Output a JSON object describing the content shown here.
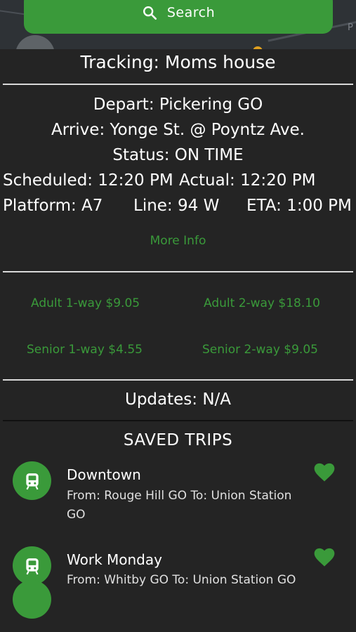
{
  "search": {
    "label": "Search"
  },
  "map": {
    "corner_letter": "P"
  },
  "tracking": {
    "title": "Tracking: Moms house",
    "depart": "Depart: Pickering GO",
    "arrive": "Arrive: Yonge St. @ Poyntz Ave.",
    "status": "Status: ON TIME",
    "scheduled": "Scheduled: 12:20 PM",
    "actual": "Actual: 12:20 PM",
    "platform": "Platform: A7",
    "line": "Line: 94 W",
    "eta": "ETA: 1:00 PM",
    "more_info": "More Info"
  },
  "fares": {
    "adult_one_way": "Adult 1-way $9.05",
    "adult_two_way": "Adult 2-way $18.10",
    "senior_one_way": "Senior 1-way $4.55",
    "senior_two_way": "Senior 2-way $9.05"
  },
  "updates": "Updates: N/A",
  "saved_trips": {
    "title": "SAVED TRIPS",
    "items": [
      {
        "name": "Downtown",
        "route": "From: Rouge Hill GO To: Union Station GO",
        "icon": "train-icon",
        "favorite": true
      },
      {
        "name": "Work Monday",
        "route": "From: Whitby GO To: Union Station GO",
        "icon": "train-icon",
        "favorite": true
      }
    ]
  },
  "colors": {
    "accent": "#3a9a3a",
    "background": "#242424",
    "text": "#ffffff"
  }
}
